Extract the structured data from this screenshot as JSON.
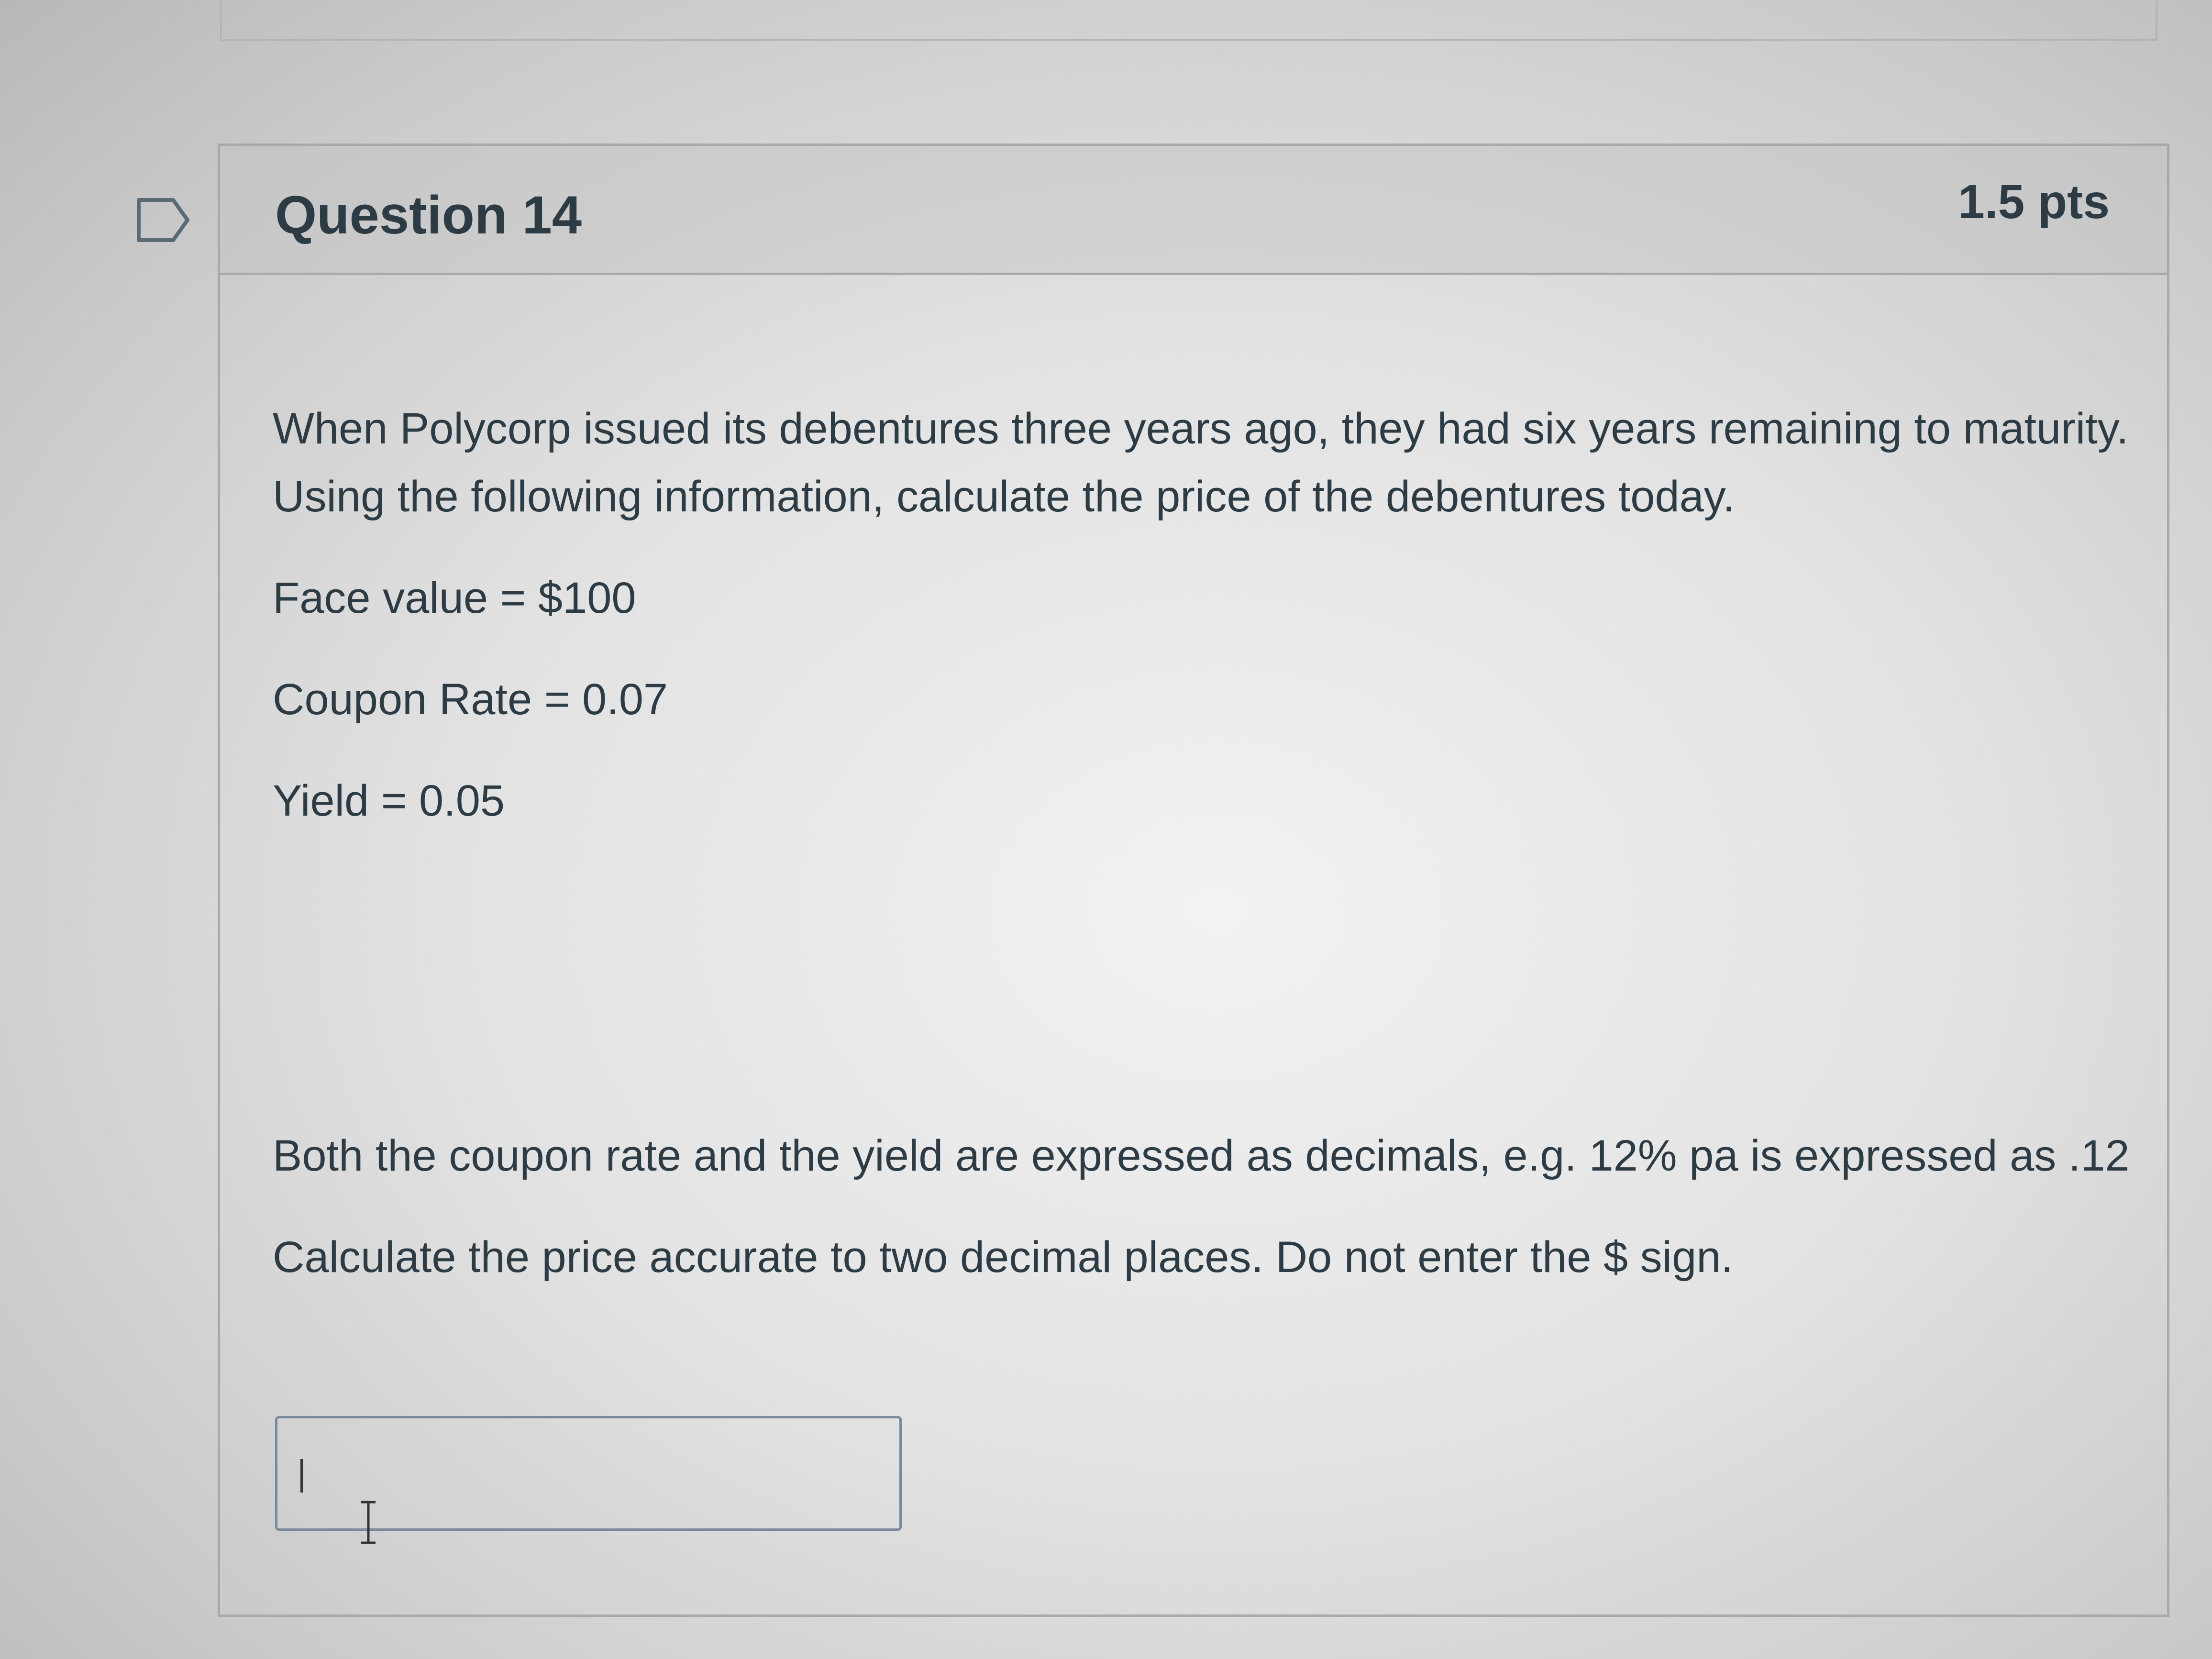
{
  "question": {
    "title": "Question 14",
    "points": "1.5 pts",
    "intro": "When Polycorp issued its debentures three years ago, they had six years remaining to maturity. Using the following information, calculate the price of the debentures today.",
    "given": [
      "Face value = $100",
      "Coupon Rate = 0.07",
      "Yield = 0.05"
    ],
    "note": "Both the coupon rate and the yield are expressed as decimals, e.g. 12% pa is expressed as .12",
    "instruction": "Calculate the price accurate to two decimal places. Do not enter the $ sign.",
    "answer_value": ""
  },
  "icons": {
    "flag": "flag-outline-icon",
    "cursor": "text-cursor-icon"
  }
}
